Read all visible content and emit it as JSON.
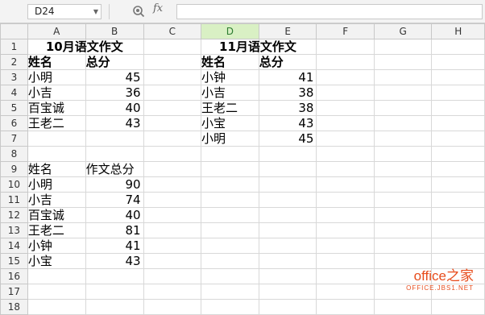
{
  "formula_bar": {
    "cell_ref": "D24",
    "fx_label": "fx",
    "formula_value": ""
  },
  "columns": [
    "A",
    "B",
    "C",
    "D",
    "E",
    "F",
    "G",
    "H"
  ],
  "selected_column": "D",
  "rows": [
    "1",
    "2",
    "3",
    "4",
    "5",
    "6",
    "7",
    "8",
    "9",
    "10",
    "11",
    "12",
    "13",
    "14",
    "15",
    "16",
    "17",
    "18"
  ],
  "table1": {
    "title": "10月语文作文",
    "header_name": "姓名",
    "header_score": "总分",
    "names": [
      "小明",
      "小吉",
      "百宝诚",
      "王老二"
    ],
    "scores": [
      "45",
      "36",
      "40",
      "43"
    ]
  },
  "table2": {
    "title": "11月语文作文",
    "header_name": "姓名",
    "header_score": "总分",
    "names": [
      "小钟",
      "小吉",
      "王老二",
      "小宝",
      "小明"
    ],
    "scores": [
      "41",
      "38",
      "38",
      "43",
      "45"
    ]
  },
  "table3": {
    "header_name": "姓名",
    "header_score": "作文总分",
    "names": [
      "小明",
      "小吉",
      "百宝诚",
      "王老二",
      "小钟",
      "小宝"
    ],
    "scores": [
      "90",
      "74",
      "40",
      "81",
      "41",
      "43"
    ]
  },
  "watermark": {
    "text": "office之家",
    "url": "OFFICE.JBS1.NET"
  },
  "colors": {
    "selected_header_bg": "#d9f0c4",
    "watermark": "#e74c1c"
  }
}
